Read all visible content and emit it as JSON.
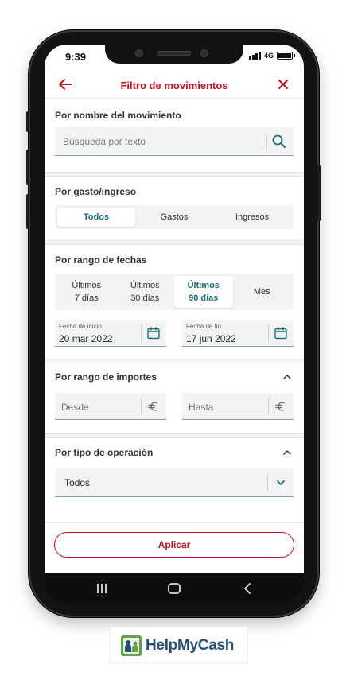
{
  "status": {
    "time": "9:39",
    "network": "4G"
  },
  "header": {
    "title": "Filtro de movimientos"
  },
  "name_section": {
    "label": "Por nombre del movimiento",
    "search_placeholder": "Búsqueda por texto"
  },
  "type_section": {
    "label": "Por gasto/ingreso",
    "options": [
      "Todos",
      "Gastos",
      "Ingresos"
    ],
    "selected": "Todos"
  },
  "date_section": {
    "label": "Por rango de fechas",
    "options": [
      {
        "line1": "Últimos",
        "line2": "7 días"
      },
      {
        "line1": "Últimos",
        "line2": "30 días"
      },
      {
        "line1": "Últimos",
        "line2": "90 días"
      },
      {
        "line1": "Mes",
        "line2": ""
      }
    ],
    "selected_index": 2,
    "start": {
      "label": "Fecha de inicio",
      "day": "20",
      "month": "mar",
      "year": "2022"
    },
    "end": {
      "label": "Fecha de fin",
      "day": "17",
      "month": "jun",
      "year": "2022"
    }
  },
  "amount_section": {
    "label": "Por rango de importes",
    "from_placeholder": "Desde",
    "to_placeholder": "Hasta",
    "currency_icon": "euro-icon"
  },
  "operation_section": {
    "label": "Por tipo de operación",
    "value": "Todos"
  },
  "apply_button": "Aplicar",
  "brand": {
    "name": "HelpMyCash"
  },
  "colors": {
    "accent": "#c4101e",
    "teal": "#1d6e74",
    "field_bg": "#f2f3f4"
  }
}
